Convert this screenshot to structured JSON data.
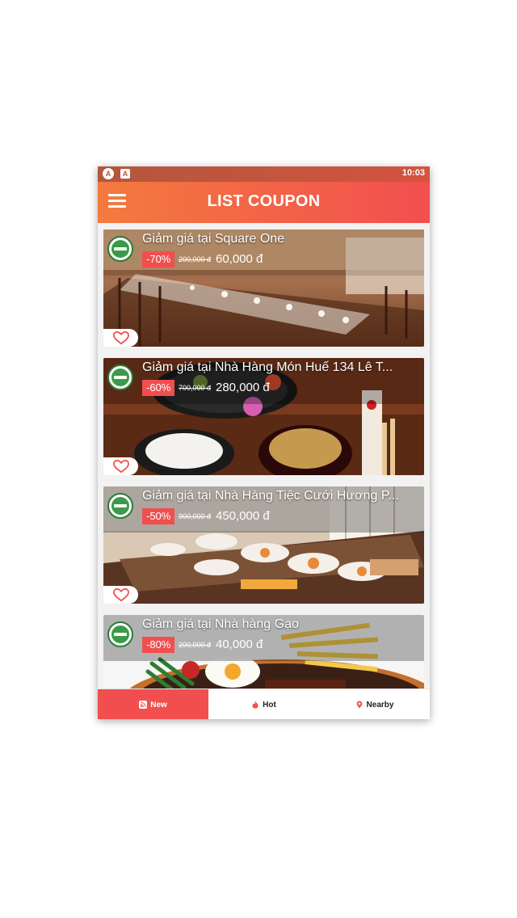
{
  "status_bar": {
    "time": "10:03",
    "icon1": "A",
    "icon2": "A"
  },
  "app_bar": {
    "title": "LIST COUPON",
    "menu_icon": "hamburger-menu-icon"
  },
  "coupons": [
    {
      "title": "Giảm giá tại Square One",
      "discount": "-70%",
      "old_price": "200,000 đ",
      "new_price": "60,000 đ"
    },
    {
      "title": "Giảm giá tại Nhà Hàng Món Huế 134 Lê T...",
      "discount": "-60%",
      "old_price": "700,000 đ",
      "new_price": "280,000 đ"
    },
    {
      "title": "Giảm giá tại Nhà Hàng Tiệc Cưới Hương P...",
      "discount": "-50%",
      "old_price": "900,000 đ",
      "new_price": "450,000 đ"
    },
    {
      "title": "Giảm giá tại Nhà hàng Gạo",
      "discount": "-80%",
      "old_price": "200,000 đ",
      "new_price": "40,000 đ"
    }
  ],
  "tabs": [
    {
      "label": "New",
      "icon": "rss-icon",
      "active": true
    },
    {
      "label": "Hot",
      "icon": "fire-icon",
      "active": false
    },
    {
      "label": "Nearby",
      "icon": "location-pin-icon",
      "active": false
    }
  ],
  "colors": {
    "accent": "#f14f4f",
    "appbar_start": "#f47a3e",
    "statusbar": "#b3563d"
  }
}
